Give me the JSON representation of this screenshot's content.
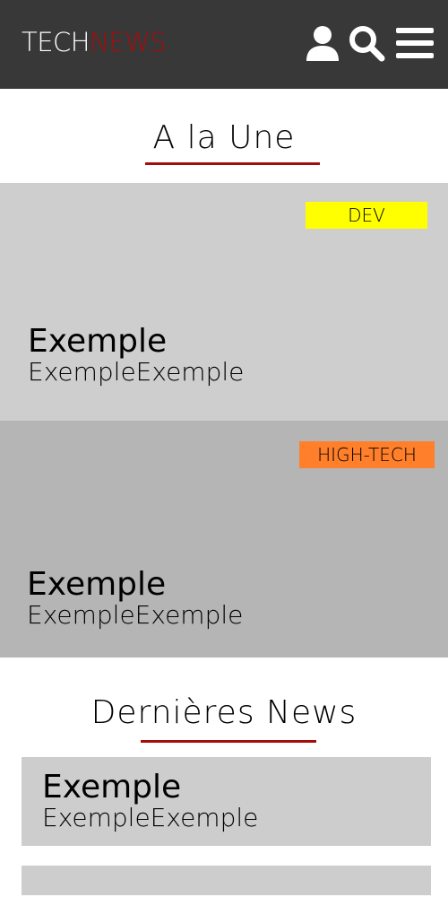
{
  "header": {
    "logo_part1": "TECH",
    "logo_part2": "NEWS",
    "icons": [
      "user-icon",
      "search-icon",
      "menu-icon"
    ]
  },
  "featured": {
    "title": "A la Une",
    "items": [
      {
        "category": "DEV",
        "category_color": "#ffff00",
        "background": "#cecece",
        "title": "Exemple",
        "subtitle": "ExempleExemple"
      },
      {
        "category": "HIGH-TECH",
        "category_color": "#ff7f2a",
        "background": "#b5b5b5",
        "title": "Exemple",
        "subtitle": "ExempleExemple"
      }
    ]
  },
  "latest": {
    "title": "Dernières News",
    "items": [
      {
        "title": "Exemple",
        "subtitle": "ExempleExemple"
      },
      {
        "title": "",
        "subtitle": ""
      }
    ]
  },
  "colors": {
    "header_bg": "#383838",
    "accent": "#a50d0d",
    "logo_text": "#ffffff"
  }
}
